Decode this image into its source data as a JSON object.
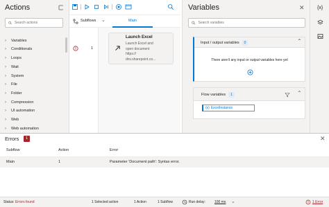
{
  "actions_pane": {
    "title": "Actions",
    "search_placeholder": "Search actions",
    "categories": [
      "Variables",
      "Conditionals",
      "Loops",
      "Wait",
      "System",
      "File",
      "Folder",
      "Compression",
      "UI automation",
      "Web",
      "Web automation"
    ]
  },
  "designer": {
    "toolbar": {
      "icons": [
        "save-icon",
        "run-icon",
        "stop-icon",
        "step-icon",
        "record-icon",
        "web-recorder-icon",
        "search-icon"
      ]
    },
    "subflows_label": "Subflows",
    "main_tab": "Main",
    "action": {
      "line_number": "1",
      "title": "Launch Excel",
      "description_lines": [
        "Launch Excel and",
        "open document",
        "https://",
        "dnv.sharepoint.co..."
      ]
    }
  },
  "variables_pane": {
    "title": "Variables",
    "search_placeholder": "Search variables",
    "io_group": {
      "title": "Input / output variables",
      "count": "0",
      "empty_message": "There aren't any input or output variables here yet"
    },
    "flow_group": {
      "title": "Flow variables",
      "count": "1",
      "variables": [
        "ExcelInstance"
      ]
    }
  },
  "errors_pane": {
    "title": "Errors",
    "count": "1",
    "columns": [
      "Subflow",
      "Action",
      "Error"
    ],
    "rows": [
      {
        "subflow": "Main",
        "action": "1",
        "error": "Parameter 'Document path': Syntax error."
      }
    ]
  },
  "statusbar": {
    "status_label": "Status:",
    "status_value": "Errors found",
    "selected": "1 Selected action",
    "actions": "1 Action",
    "subflows": "1 Subflow",
    "run_delay_label": "Run delay:",
    "run_delay_value": "100 ms",
    "error_count": "1 Error"
  },
  "colors": {
    "accent": "#0078d4",
    "error": "#a4262c",
    "pane_bg": "#f3f2f1"
  }
}
